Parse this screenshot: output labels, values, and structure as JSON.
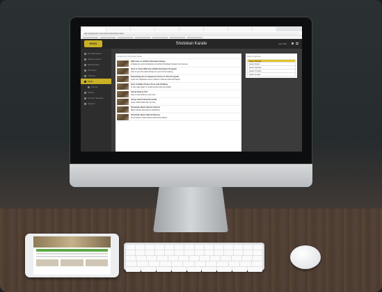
{
  "browser": {
    "url": "app.gogogoaim.com/videos/shotokan-kata",
    "tab_count": 8
  },
  "app": {
    "logo_text": "GOGO",
    "page_title": "Shotokan Karate",
    "user_label": "yoyo Kiki"
  },
  "sidebar": {
    "items": [
      {
        "label": "My Dashboard",
        "active": false
      },
      {
        "label": "Video Lessons",
        "active": false
      },
      {
        "label": "Membership",
        "active": false
      },
      {
        "label": "Schedule",
        "active": false
      },
      {
        "label": "Training",
        "active": false
      },
      {
        "label": "Katas",
        "active": true
      },
      {
        "label": "Kumite",
        "active": false
      },
      {
        "label": "Gallery",
        "active": false
      },
      {
        "label": "Account Settings",
        "active": false
      },
      {
        "label": "Support",
        "active": false
      }
    ]
  },
  "videos": {
    "header": "Lessons by Shotokan Kata",
    "items": [
      {
        "title": "Welcome to GOGO Shotokan Karate",
        "desc": "A Welcome and Introduction to GOGO Shotokan Karate from Sensei"
      },
      {
        "title": "How to Train With the GOGO Shotokan Program",
        "desc": "How to use this video library for your home training"
      },
      {
        "title": "Stretching Set of Japanese Terms in This Program",
        "desc": "Learn the Japanese terms used for stances and techniques"
      },
      {
        "title": "How to Make Proper Fists and Striking",
        "desc": "In this video learn to make proper fists and strike"
      },
      {
        "title": "About Kata & Tori",
        "desc": "How to train kata on your own"
      },
      {
        "title": "About Taichi Kata Renshiki",
        "desc": "Learn Taichi kata step by step"
      },
      {
        "title": "Shotokan Basic Block Tutorial",
        "desc": "Basic blocks and stance transitions"
      },
      {
        "title": "Shotokan Basic Block Stances",
        "desc": "Front stance, back stance and horse stance"
      }
    ]
  },
  "playlist": {
    "header": "Kata Programs",
    "items": [
      "Heian Shodan",
      "Heian Nidan",
      "Heian Sandan",
      "Heian Yondan",
      "Heian Godan"
    ]
  },
  "colors": {
    "accent": "#c9b025",
    "sidebar_bg": "#2d2d2d",
    "topbar_bg": "#262626"
  }
}
